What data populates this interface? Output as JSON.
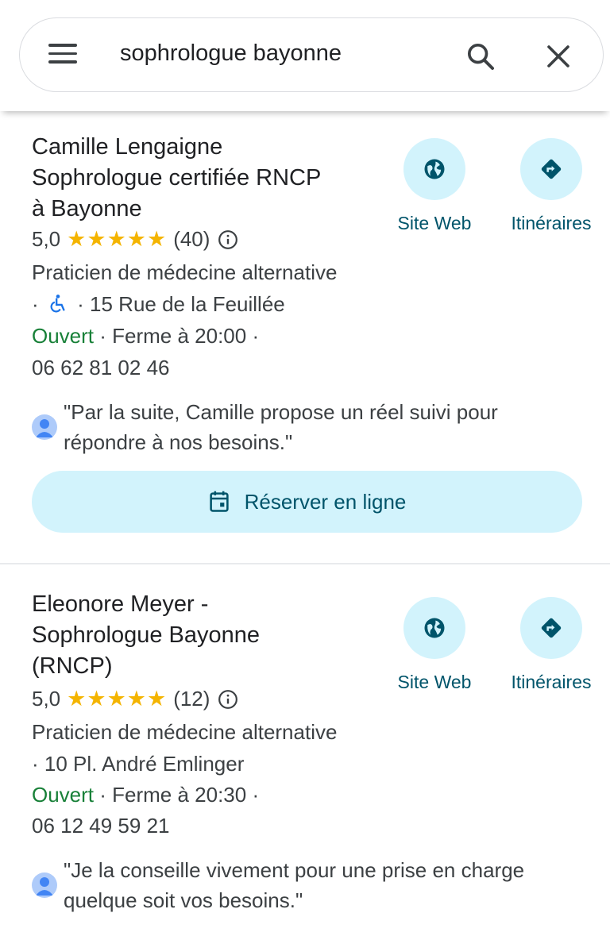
{
  "search": {
    "query": "sophrologue bayonne"
  },
  "results": [
    {
      "title_lines": [
        "Camille Lengaigne",
        "Sophrologue certifiée RNCP",
        "à Bayonne"
      ],
      "rating": "5,0",
      "stars": "★★★★★",
      "reviews": "(40)",
      "category": "Praticien de médecine alternative",
      "address_prefix": "·",
      "address": "· 15 Rue de la Feuillée",
      "status": "Ouvert",
      "hours": " · Ferme à 20:00 ·",
      "phone": "06 62 81 02 46",
      "review": "\"Par la suite, Camille propose un réel suivi pour répondre à nos besoins.\"",
      "website_label": "Site Web",
      "directions_label": "Itinéraires",
      "book_label": "Réserver en ligne"
    },
    {
      "title_lines": [
        "Eleonore Meyer -",
        "Sophrologue Bayonne",
        "(RNCP)"
      ],
      "rating": "5,0",
      "stars": "★★★★★",
      "reviews": "(12)",
      "category": "Praticien de médecine alternative",
      "address": "· 10 Pl. André Emlinger",
      "status": "Ouvert",
      "hours": " · Ferme à 20:30 ·",
      "phone": "06 12 49 59 21",
      "review": "\"Je la conseille vivement pour une prise en charge quelque soit vos besoins.\"",
      "website_label": "Site Web",
      "directions_label": "Itinéraires"
    }
  ],
  "icons": {
    "menu": "menu-icon",
    "search": "search-icon",
    "close": "close-icon",
    "website": "globe-icon",
    "directions": "directions-icon",
    "info": "info-icon",
    "wheelchair": "wheelchair-icon",
    "calendar": "calendar-icon",
    "avatar": "person-icon"
  },
  "colors": {
    "accent_bg": "#d2f3fc",
    "accent_text": "#00546a",
    "open": "#188038",
    "stars": "#f4b400"
  }
}
